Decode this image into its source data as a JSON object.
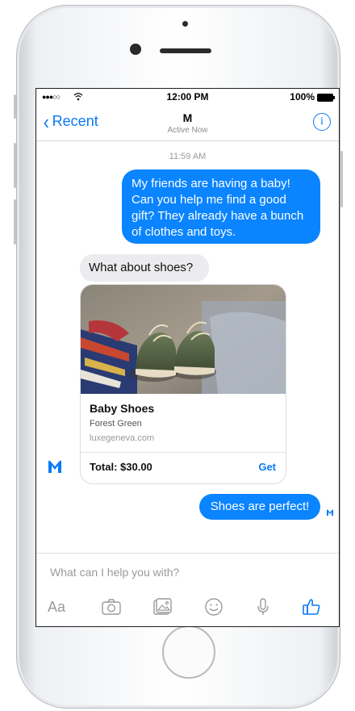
{
  "status_bar": {
    "time": "12:00 PM",
    "battery": "100%"
  },
  "nav": {
    "back_label": "Recent",
    "title": "M",
    "subtitle": "Active Now",
    "info_glyph": "i"
  },
  "conversation": {
    "timestamp": "11:59 AM",
    "messages": [
      {
        "text": "My friends are having a baby! Can you help me find a good gift? They already have a bunch of clothes and toys."
      },
      {
        "text": "What about shoes?"
      },
      {
        "text": "Shoes are perfect!"
      }
    ],
    "card": {
      "title": "Baby Shoes",
      "subtitle": "Forest Green",
      "url": "luxegeneva.com",
      "total": "Total: $30.00",
      "action": "Get"
    }
  },
  "composer": {
    "placeholder": "What can I help you with?",
    "text_tool_label": "Aa",
    "tools": [
      "text-icon",
      "camera-icon",
      "gallery-icon",
      "emoji-icon",
      "microphone-icon",
      "thumbs-up-icon"
    ]
  },
  "colors": {
    "accent": "#0a7af5",
    "outgoing_bubble": "#0a84ff",
    "incoming_bubble": "#ececee"
  }
}
